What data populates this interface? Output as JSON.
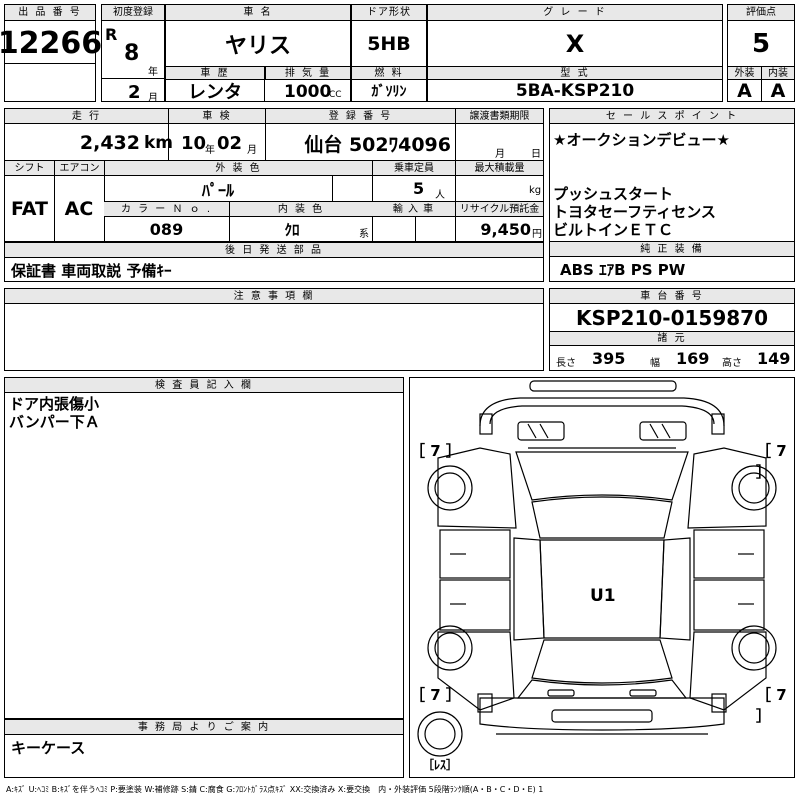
{
  "header": {
    "lot_label": "出 品 番 号",
    "lot_no": "12266",
    "first_reg_label": "初度登録",
    "era": "R",
    "year": "8",
    "year_unit": "年",
    "month": "2",
    "month_unit": "月",
    "car_name_label": "車 名",
    "car_name": "ヤリス",
    "history_label": "車 歴",
    "history": "レンタ",
    "displacement_label": "排 気 量",
    "displacement": "1000",
    "displacement_unit": "CC",
    "door_label": "ドア形状",
    "door": "5HB",
    "fuel_label": "燃 料",
    "fuel": "ｶﾞｿﾘﾝ",
    "grade_label": "グ レ ー ド",
    "grade": "X",
    "model_label": "型 式",
    "model": "5BA-KSP210",
    "score_label": "評価点",
    "score": "5",
    "ext_label": "外装",
    "ext": "A",
    "int_label": "内装",
    "int": "A"
  },
  "specs": {
    "mileage_label": "走 行",
    "mileage": "2,432",
    "mileage_unit": "km",
    "inspection_label": "車 検",
    "inspection_year": "10",
    "inspection_year_unit": "年",
    "inspection_month": "02",
    "inspection_month_unit": "月",
    "plate_label": "登 録 番 号",
    "plate": "仙台 502ﾜ4096",
    "transfer_label": "譲渡書類期限",
    "transfer_month": "月",
    "transfer_day": "日",
    "shift_label": "シフト",
    "shift": "FAT",
    "ac_label": "エアコン",
    "ac": "AC",
    "color_label": "外 装 色",
    "color": "ﾊﾟｰﾙ",
    "capacity_label": "乗車定員",
    "capacity": "5",
    "capacity_unit": "人",
    "load_label": "最大積載量",
    "load_unit": "kg",
    "color_no_label": "カ ラ ー Ｎ ｏ .",
    "color_no": "089",
    "interior_label": "内 装 色",
    "interior": "ｸﾛ",
    "interior_unit": "系",
    "import_label": "輸 入 車",
    "recycle_label": "リサイクル預託金",
    "recycle": "9,450",
    "recycle_unit": "円"
  },
  "later_parts": {
    "label": "後 日 発 送 部 品",
    "text": "保証書 車両取説 予備ｷｰ"
  },
  "sales_point": {
    "label": "セ ー ル ス ポ イ ン ト",
    "lines": [
      "★オークションデビュー★",
      "",
      "",
      "プッシュスタート",
      "トヨタセーフティセンス",
      "ビルトインＥＴＣ"
    ]
  },
  "equipment": {
    "label": "純 正 装 備",
    "text": "ABS ｴｱB PS PW"
  },
  "notes": {
    "label": "注 意 事 項 欄",
    "text": ""
  },
  "chassis": {
    "label": "車 台 番 号",
    "value": "KSP210-0159870"
  },
  "dimensions": {
    "label": "諸 元",
    "length_label": "長さ",
    "length": "395",
    "width_label": "幅",
    "width": "169",
    "height_label": "高さ",
    "height": "149"
  },
  "inspector": {
    "label": "検 査 員 記 入 欄",
    "lines": [
      "ドア内張傷小",
      "バンパー下Ａ"
    ]
  },
  "office": {
    "label": "事 務 局 よ り ご 案 内",
    "text": "キーケース"
  },
  "diagram": {
    "tire_fl": "［ 7 ］",
    "tire_fr": "［ 7 ］",
    "tire_rl": "［ 7 ］",
    "tire_rr": "［ 7 ］",
    "spare": "［ﾚｽ］",
    "mark": "U1"
  },
  "legend": "A:ｷｽﾞ U:ﾍｺﾐ B:ｷｽﾞを伴うﾍｺﾐ P:要塗装 W:補修跡 S:錆 C:腐食 G:ﾌﾛﾝﾄｶﾞﾗｽ点ｷｽﾞ XX:交換済み X:要交換　内・外装評価 5段階ﾗﾝｸ順(A・B・C・D・E) 1"
}
